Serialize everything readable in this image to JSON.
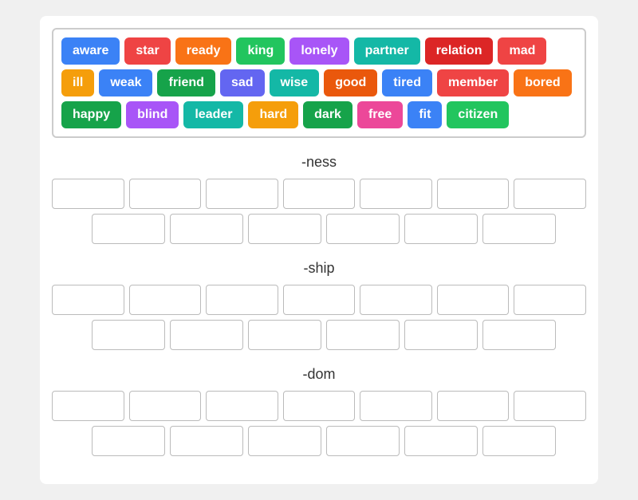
{
  "wordBank": [
    {
      "label": "aware",
      "color": "blue"
    },
    {
      "label": "star",
      "color": "red"
    },
    {
      "label": "ready",
      "color": "orange"
    },
    {
      "label": "king",
      "color": "green"
    },
    {
      "label": "lonely",
      "color": "purple"
    },
    {
      "label": "partner",
      "color": "teal"
    },
    {
      "label": "relation",
      "color": "dark-red"
    },
    {
      "label": "mad",
      "color": "red"
    },
    {
      "label": "ill",
      "color": "amber"
    },
    {
      "label": "weak",
      "color": "blue"
    },
    {
      "label": "friend",
      "color": "dark-green"
    },
    {
      "label": "sad",
      "color": "indigo"
    },
    {
      "label": "wise",
      "color": "teal"
    },
    {
      "label": "good",
      "color": "dark-orange"
    },
    {
      "label": "tired",
      "color": "blue"
    },
    {
      "label": "member",
      "color": "red"
    },
    {
      "label": "bored",
      "color": "orange"
    },
    {
      "label": "happy",
      "color": "dark-green"
    },
    {
      "label": "blind",
      "color": "purple"
    },
    {
      "label": "leader",
      "color": "teal"
    },
    {
      "label": "hard",
      "color": "amber"
    },
    {
      "label": "dark",
      "color": "dark-green"
    },
    {
      "label": "free",
      "color": "pink"
    },
    {
      "label": "fit",
      "color": "blue"
    },
    {
      "label": "citizen",
      "color": "green"
    }
  ],
  "sections": [
    {
      "title": "-ness",
      "row1Count": 7,
      "row2Count": 6
    },
    {
      "title": "-ship",
      "row1Count": 7,
      "row2Count": 6
    },
    {
      "title": "-dom",
      "row1Count": 7,
      "row2Count": 6
    }
  ]
}
